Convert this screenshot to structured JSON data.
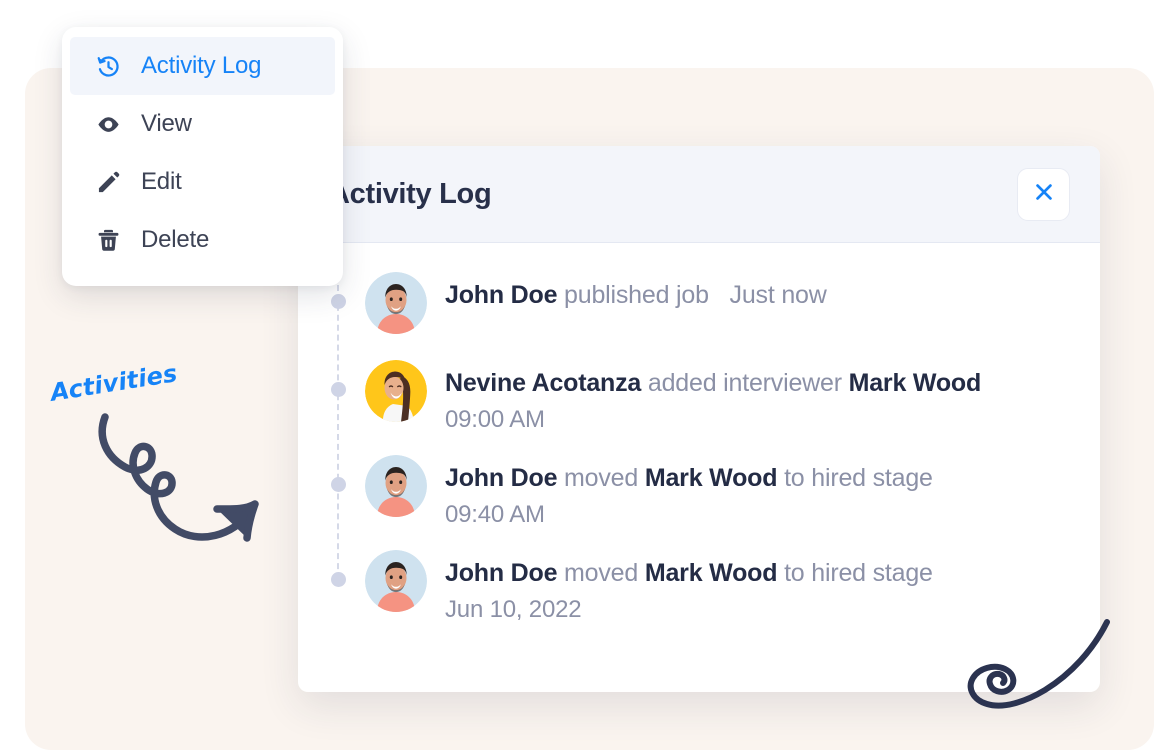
{
  "theme": {
    "backdrop_color": "#faf4ef",
    "accent_blue": "#1683f7",
    "header_bg": "#f3f5fa",
    "dark_text": "#242c45",
    "muted_text": "#8b90a6",
    "dot_color": "#cfd4e6",
    "swirl_color": "#2b3350"
  },
  "context_menu": {
    "items": [
      {
        "label": "Activity Log",
        "icon": "history-icon",
        "active": true
      },
      {
        "label": "View",
        "icon": "eye-icon",
        "active": false
      },
      {
        "label": "Edit",
        "icon": "pencil-icon",
        "active": false
      },
      {
        "label": "Delete",
        "icon": "trash-icon",
        "active": false
      }
    ]
  },
  "modal": {
    "title": "Activity Log",
    "close_icon": "close-icon",
    "activities": [
      {
        "avatar": "avatar-john-doe",
        "actor": "John Doe",
        "action": "published job",
        "target": "",
        "suffix": "",
        "when_inline": "Just now",
        "time": ""
      },
      {
        "avatar": "avatar-nevine-acotanza",
        "actor": "Nevine Acotanza",
        "action": "added interviewer",
        "target": "Mark Wood",
        "suffix": "",
        "when_inline": "",
        "time": "09:00 AM"
      },
      {
        "avatar": "avatar-john-doe",
        "actor": "John Doe",
        "action": "moved",
        "target": "Mark Wood",
        "suffix": "to hired stage",
        "when_inline": "",
        "time": "09:40 AM"
      },
      {
        "avatar": "avatar-john-doe",
        "actor": "John Doe",
        "action": "moved",
        "target": "Mark Wood",
        "suffix": "to hired stage",
        "when_inline": "",
        "time": "Jun 10, 2022"
      }
    ]
  },
  "annotations": {
    "activities_label": "Activities",
    "curly_arrow_icon": "curly-arrow-icon",
    "swirl_icon": "swirl-flourish-icon"
  }
}
